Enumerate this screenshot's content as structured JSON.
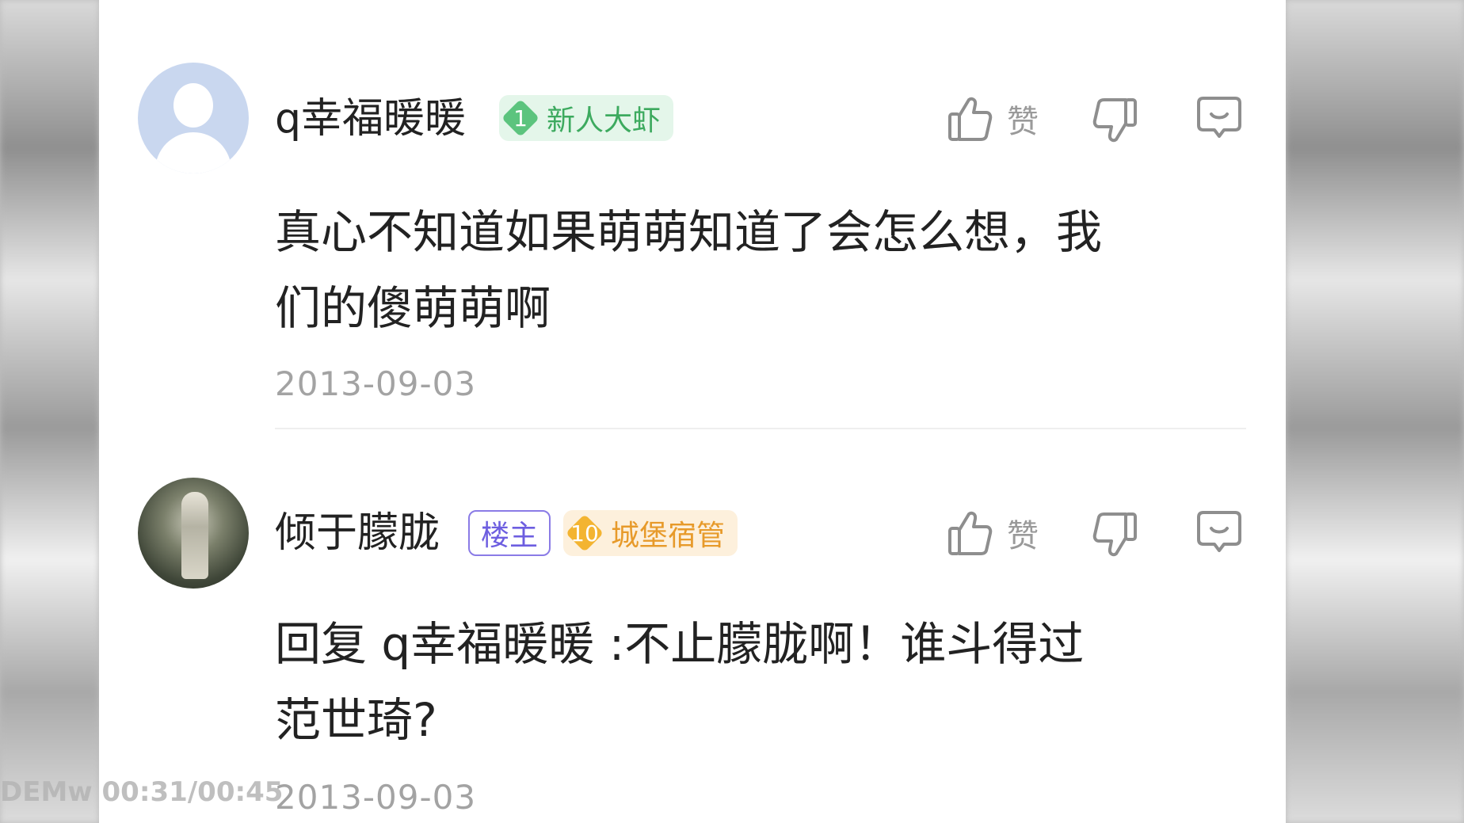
{
  "comments": [
    {
      "avatar": "default-avatar",
      "username": "q幸福暖暖",
      "level": "1",
      "level_title": "新人大虾",
      "like_label": "赞",
      "content": "真心不知道如果萌萌知道了会怎么想，我们的傻萌萌啊",
      "date": "2013-09-03"
    },
    {
      "avatar": "photo-avatar",
      "username": "倾于朦胧",
      "owner_tag": "楼主",
      "level": "10",
      "level_title": "城堡宿管",
      "like_label": "赞",
      "content": "回复 q幸福暖暖 :不止朦胧啊！谁斗得过范世琦?",
      "date": "2013-09-03"
    }
  ],
  "watermark": "DEMw 00:31/00:45",
  "icons": [
    "thumbs-up-icon",
    "thumbs-down-icon",
    "reply-bubble-icon"
  ],
  "colors": {
    "level_green": "#5cc47e",
    "level_gold": "#f3b431",
    "owner_purple": "#6d5ee0"
  }
}
